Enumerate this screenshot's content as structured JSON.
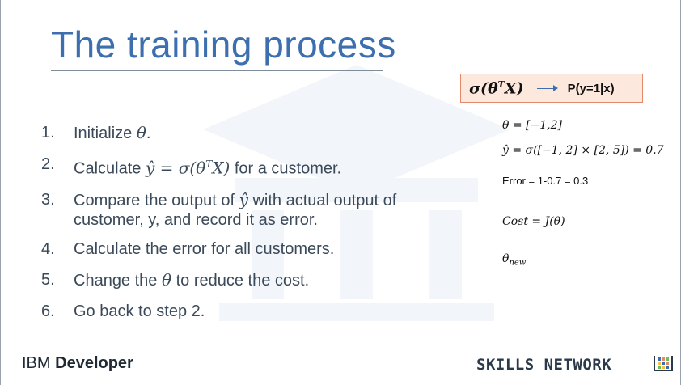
{
  "title": "The training process",
  "formula_box": {
    "left": "σ(θ",
    "sup": "T",
    "right": "X)",
    "result": "P(y=1|x)"
  },
  "steps": [
    {
      "num": "1.",
      "pre": "Initialize ",
      "math": "θ",
      "post": "."
    },
    {
      "num": "2.",
      "pre": "Calculate ",
      "math": "ŷ = σ(θ",
      "sup": "T",
      "math2": "X)",
      "post": " for a customer."
    },
    {
      "num": "3.",
      "pre": "Compare the output of ",
      "math": "ŷ",
      "post": " with actual output of customer, y, and record it as error."
    },
    {
      "num": "4.",
      "text": "Calculate the error for all customers."
    },
    {
      "num": "5.",
      "pre": "Change the ",
      "math": "θ",
      "post": " to reduce the cost."
    },
    {
      "num": "6.",
      "text": "Go back to step 2."
    }
  ],
  "side": {
    "theta": "θ  =  [−1,2]",
    "yhat": "ŷ = σ([−1, 2]  ×  [2, 5])  =   0.7",
    "error": "Error = 1-0.7 = 0.3",
    "cost": "Cost  =  J(θ)",
    "theta_new": "θ",
    "theta_new_sub": "new"
  },
  "footer": {
    "brand_light": "IBM ",
    "brand_bold": "Developer",
    "network": "SKILLS NETWORK"
  },
  "icons": {
    "arrow": "right-arrow-icon",
    "logo": "skills-network-logo-icon"
  }
}
